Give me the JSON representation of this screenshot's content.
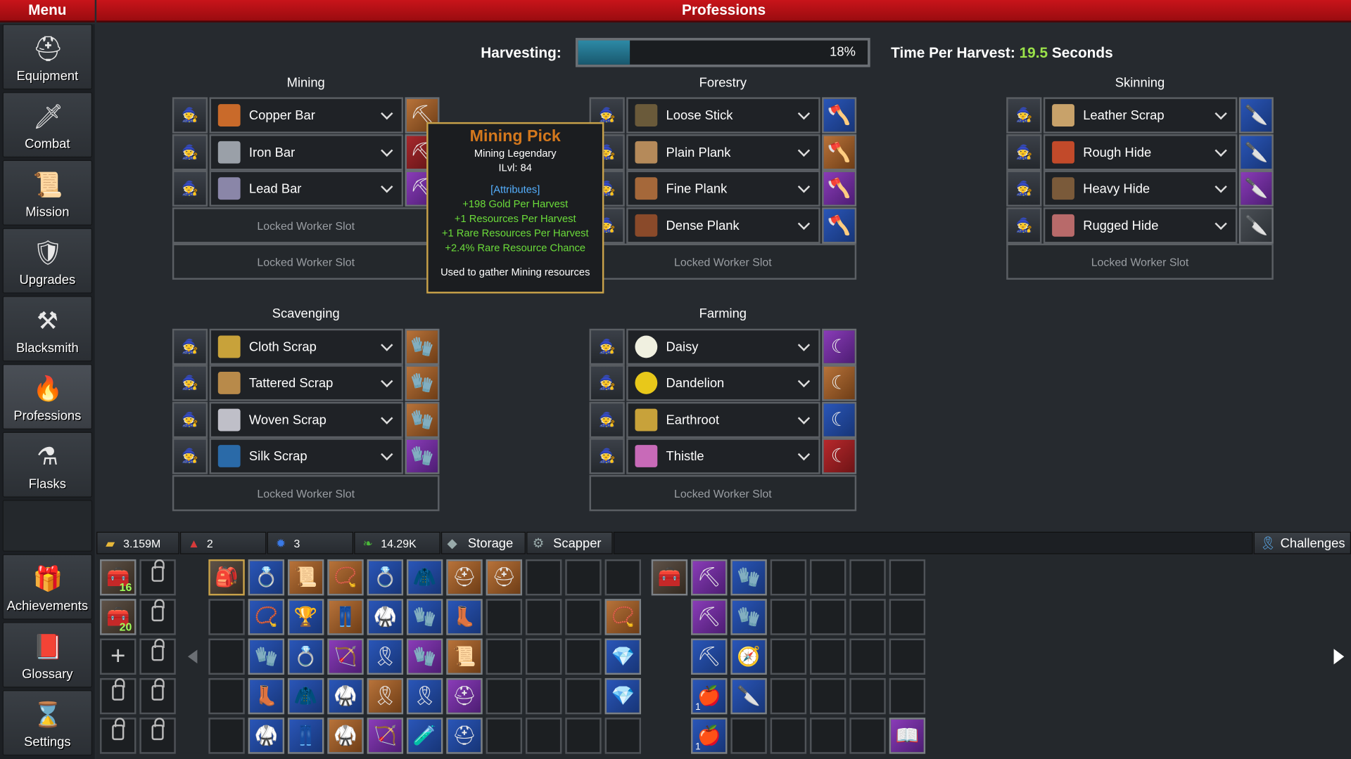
{
  "header": {
    "menu_title": "Menu",
    "page_title": "Professions"
  },
  "nav": [
    {
      "label": "Equipment",
      "icon": "helmet-icon"
    },
    {
      "label": "Combat",
      "icon": "sword-icon"
    },
    {
      "label": "Mission",
      "icon": "scroll-icon"
    },
    {
      "label": "Upgrades",
      "icon": "shield-icon"
    },
    {
      "label": "Blacksmith",
      "icon": "anvil-icon"
    },
    {
      "label": "Professions",
      "icon": "flame-icon"
    },
    {
      "label": "Flasks",
      "icon": "flask-icon"
    },
    {
      "label": "Achievements",
      "icon": "chest-icon"
    },
    {
      "label": "Glossary",
      "icon": "book-icon"
    },
    {
      "label": "Settings",
      "icon": "hourglass-icon"
    }
  ],
  "harvest": {
    "label": "Harvesting:",
    "percent_text": "18%",
    "progress": 0.18,
    "time_label": "Time Per Harvest:",
    "time_value": "19.5",
    "time_unit": "Seconds"
  },
  "locked_text": "Locked Worker Slot",
  "professions": {
    "mining": {
      "title": "Mining",
      "rows": [
        "Copper Bar",
        "Iron Bar",
        "Lead Bar"
      ]
    },
    "forestry": {
      "title": "Forestry",
      "rows": [
        "Loose Stick",
        "Plain Plank",
        "Fine Plank",
        "Dense Plank"
      ]
    },
    "skinning": {
      "title": "Skinning",
      "rows": [
        "Leather Scrap",
        "Rough Hide",
        "Heavy Hide",
        "Rugged Hide"
      ]
    },
    "scavenging": {
      "title": "Scavenging",
      "rows": [
        "Cloth Scrap",
        "Tattered Scrap",
        "Woven Scrap",
        "Silk Scrap"
      ]
    },
    "farming": {
      "title": "Farming",
      "rows": [
        "Daisy",
        "Dandelion",
        "Earthroot",
        "Thistle"
      ]
    }
  },
  "tooltip": {
    "title": "Mining Pick",
    "subtitle": "Mining Legendary",
    "ilvl": "ILvl: 84",
    "attributes_label": "[Attributes]",
    "attributes": [
      "+198 Gold Per Harvest",
      "+1 Resources Per Harvest",
      "+1 Rare Resources Per Harvest",
      "+2.4% Rare Resource Chance"
    ],
    "description": "Used to gather Mining resources"
  },
  "stats": {
    "gold": "3.159M",
    "tickets": "2",
    "gems": "3",
    "essence": "14.29K"
  },
  "tabs": {
    "storage": "Storage",
    "scrapper": "Scapper",
    "challenges": "Challenges"
  },
  "inventory": {
    "chest_count_1": "16",
    "chest_count_2": "20",
    "stack_1": "1",
    "stack_2": "1"
  },
  "colors": {
    "accent_red": "#c8141a",
    "progress_teal": "#2d8aa6",
    "legendary_orange": "#d4781d",
    "attribute_green": "#6bdc3a"
  }
}
